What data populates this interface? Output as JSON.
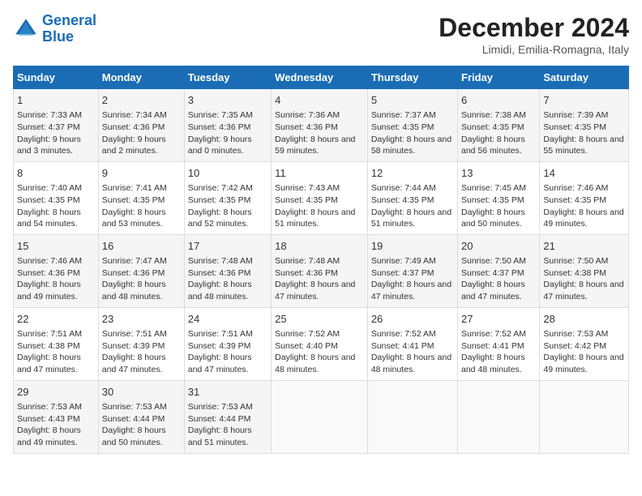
{
  "header": {
    "logo_line1": "General",
    "logo_line2": "Blue",
    "month": "December 2024",
    "location": "Limidi, Emilia-Romagna, Italy"
  },
  "days_of_week": [
    "Sunday",
    "Monday",
    "Tuesday",
    "Wednesday",
    "Thursday",
    "Friday",
    "Saturday"
  ],
  "weeks": [
    [
      {
        "day": 1,
        "sunrise": "7:33 AM",
        "sunset": "4:37 PM",
        "daylight": "9 hours and 3 minutes."
      },
      {
        "day": 2,
        "sunrise": "7:34 AM",
        "sunset": "4:36 PM",
        "daylight": "9 hours and 2 minutes."
      },
      {
        "day": 3,
        "sunrise": "7:35 AM",
        "sunset": "4:36 PM",
        "daylight": "9 hours and 0 minutes."
      },
      {
        "day": 4,
        "sunrise": "7:36 AM",
        "sunset": "4:36 PM",
        "daylight": "8 hours and 59 minutes."
      },
      {
        "day": 5,
        "sunrise": "7:37 AM",
        "sunset": "4:35 PM",
        "daylight": "8 hours and 58 minutes."
      },
      {
        "day": 6,
        "sunrise": "7:38 AM",
        "sunset": "4:35 PM",
        "daylight": "8 hours and 56 minutes."
      },
      {
        "day": 7,
        "sunrise": "7:39 AM",
        "sunset": "4:35 PM",
        "daylight": "8 hours and 55 minutes."
      }
    ],
    [
      {
        "day": 8,
        "sunrise": "7:40 AM",
        "sunset": "4:35 PM",
        "daylight": "8 hours and 54 minutes."
      },
      {
        "day": 9,
        "sunrise": "7:41 AM",
        "sunset": "4:35 PM",
        "daylight": "8 hours and 53 minutes."
      },
      {
        "day": 10,
        "sunrise": "7:42 AM",
        "sunset": "4:35 PM",
        "daylight": "8 hours and 52 minutes."
      },
      {
        "day": 11,
        "sunrise": "7:43 AM",
        "sunset": "4:35 PM",
        "daylight": "8 hours and 51 minutes."
      },
      {
        "day": 12,
        "sunrise": "7:44 AM",
        "sunset": "4:35 PM",
        "daylight": "8 hours and 51 minutes."
      },
      {
        "day": 13,
        "sunrise": "7:45 AM",
        "sunset": "4:35 PM",
        "daylight": "8 hours and 50 minutes."
      },
      {
        "day": 14,
        "sunrise": "7:46 AM",
        "sunset": "4:35 PM",
        "daylight": "8 hours and 49 minutes."
      }
    ],
    [
      {
        "day": 15,
        "sunrise": "7:46 AM",
        "sunset": "4:36 PM",
        "daylight": "8 hours and 49 minutes."
      },
      {
        "day": 16,
        "sunrise": "7:47 AM",
        "sunset": "4:36 PM",
        "daylight": "8 hours and 48 minutes."
      },
      {
        "day": 17,
        "sunrise": "7:48 AM",
        "sunset": "4:36 PM",
        "daylight": "8 hours and 48 minutes."
      },
      {
        "day": 18,
        "sunrise": "7:48 AM",
        "sunset": "4:36 PM",
        "daylight": "8 hours and 47 minutes."
      },
      {
        "day": 19,
        "sunrise": "7:49 AM",
        "sunset": "4:37 PM",
        "daylight": "8 hours and 47 minutes."
      },
      {
        "day": 20,
        "sunrise": "7:50 AM",
        "sunset": "4:37 PM",
        "daylight": "8 hours and 47 minutes."
      },
      {
        "day": 21,
        "sunrise": "7:50 AM",
        "sunset": "4:38 PM",
        "daylight": "8 hours and 47 minutes."
      }
    ],
    [
      {
        "day": 22,
        "sunrise": "7:51 AM",
        "sunset": "4:38 PM",
        "daylight": "8 hours and 47 minutes."
      },
      {
        "day": 23,
        "sunrise": "7:51 AM",
        "sunset": "4:39 PM",
        "daylight": "8 hours and 47 minutes."
      },
      {
        "day": 24,
        "sunrise": "7:51 AM",
        "sunset": "4:39 PM",
        "daylight": "8 hours and 47 minutes."
      },
      {
        "day": 25,
        "sunrise": "7:52 AM",
        "sunset": "4:40 PM",
        "daylight": "8 hours and 48 minutes."
      },
      {
        "day": 26,
        "sunrise": "7:52 AM",
        "sunset": "4:41 PM",
        "daylight": "8 hours and 48 minutes."
      },
      {
        "day": 27,
        "sunrise": "7:52 AM",
        "sunset": "4:41 PM",
        "daylight": "8 hours and 48 minutes."
      },
      {
        "day": 28,
        "sunrise": "7:53 AM",
        "sunset": "4:42 PM",
        "daylight": "8 hours and 49 minutes."
      }
    ],
    [
      {
        "day": 29,
        "sunrise": "7:53 AM",
        "sunset": "4:43 PM",
        "daylight": "8 hours and 49 minutes."
      },
      {
        "day": 30,
        "sunrise": "7:53 AM",
        "sunset": "4:44 PM",
        "daylight": "8 hours and 50 minutes."
      },
      {
        "day": 31,
        "sunrise": "7:53 AM",
        "sunset": "4:44 PM",
        "daylight": "8 hours and 51 minutes."
      },
      null,
      null,
      null,
      null
    ]
  ],
  "labels": {
    "sunrise": "Sunrise:",
    "sunset": "Sunset:",
    "daylight": "Daylight:"
  }
}
